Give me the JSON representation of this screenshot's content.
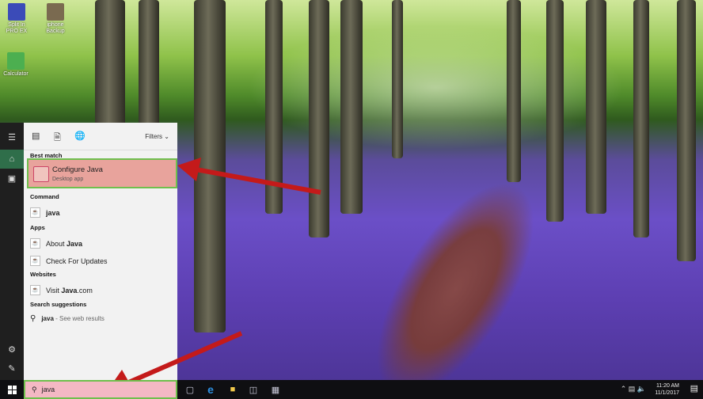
{
  "desktop": {
    "icons": [
      {
        "label": "Split In PRO EX",
        "name": "split-in-pro-icon",
        "color": "#3b4bb8"
      },
      {
        "label": "iphone Backup",
        "name": "iphone-backup-icon",
        "color": "#7a6a50"
      },
      {
        "label": "Calculator",
        "name": "calculator-icon",
        "color": "#4caf50"
      }
    ]
  },
  "start_menu": {
    "tabs": [
      "apps-tab-icon",
      "documents-tab-icon",
      "web-tab-icon"
    ],
    "filters_label": "Filters",
    "sections": {
      "best_match": "Best match",
      "command": "Command",
      "apps": "Apps",
      "websites": "Websites",
      "search_suggestions": "Search suggestions"
    },
    "best_match": {
      "title_pre": "Configure ",
      "title_bold": "Java",
      "subtitle": "Desktop app"
    },
    "command_item": "java",
    "apps": [
      {
        "pre": "About ",
        "bold": "Java"
      },
      {
        "pre": "Check For Updates",
        "bold": ""
      }
    ],
    "websites": [
      {
        "pre": "Visit ",
        "bold": "Java",
        "post": ".com"
      }
    ],
    "suggestion": {
      "bold": "java",
      "rest": " - See web results"
    }
  },
  "taskbar": {
    "search_value": "java",
    "time": "11:20 AM",
    "date": "11/1/2017"
  },
  "colors": {
    "highlight": "#e8a39c",
    "outline": "#6fbf4d",
    "arrow": "#c41a1a"
  }
}
